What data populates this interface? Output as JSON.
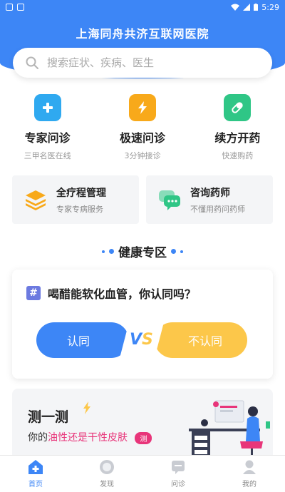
{
  "status_bar": {
    "time": "5:29"
  },
  "header": {
    "title": "上海同舟共济互联网医院"
  },
  "search": {
    "placeholder": "搜索症状、疾病、医生"
  },
  "services": [
    {
      "title": "专家问诊",
      "subtitle": "三甲名医在线",
      "icon": "plus-icon",
      "color": "#2fa9f0"
    },
    {
      "title": "极速问诊",
      "subtitle": "3分钟接诊",
      "icon": "lightning-icon",
      "color": "#f8a91a"
    },
    {
      "title": "续方开药",
      "subtitle": "快速购药",
      "icon": "pill-icon",
      "color": "#2fc686"
    }
  ],
  "cards": [
    {
      "title": "全疗程管理",
      "subtitle": "专家专病服务",
      "icon": "layers-icon"
    },
    {
      "title": "咨询药师",
      "subtitle": "不懂用药问药师",
      "icon": "chat-icon"
    }
  ],
  "health_zone": {
    "title": "健康专区",
    "question": "喝醋能软化血管，你认同吗？",
    "agree": "认同",
    "disagree": "不认同",
    "vs": "VS"
  },
  "test": {
    "title": "测一测",
    "prefix": "你的",
    "highlight": "油性还是干性皮肤",
    "button": "测"
  },
  "tabbar": [
    {
      "label": "首页",
      "active": true
    },
    {
      "label": "发现",
      "active": false
    },
    {
      "label": "问诊",
      "active": false
    },
    {
      "label": "我的",
      "active": false
    }
  ],
  "colors": {
    "primary": "#3d86f6",
    "yellow": "#fcc74a",
    "pink": "#e8357a"
  }
}
